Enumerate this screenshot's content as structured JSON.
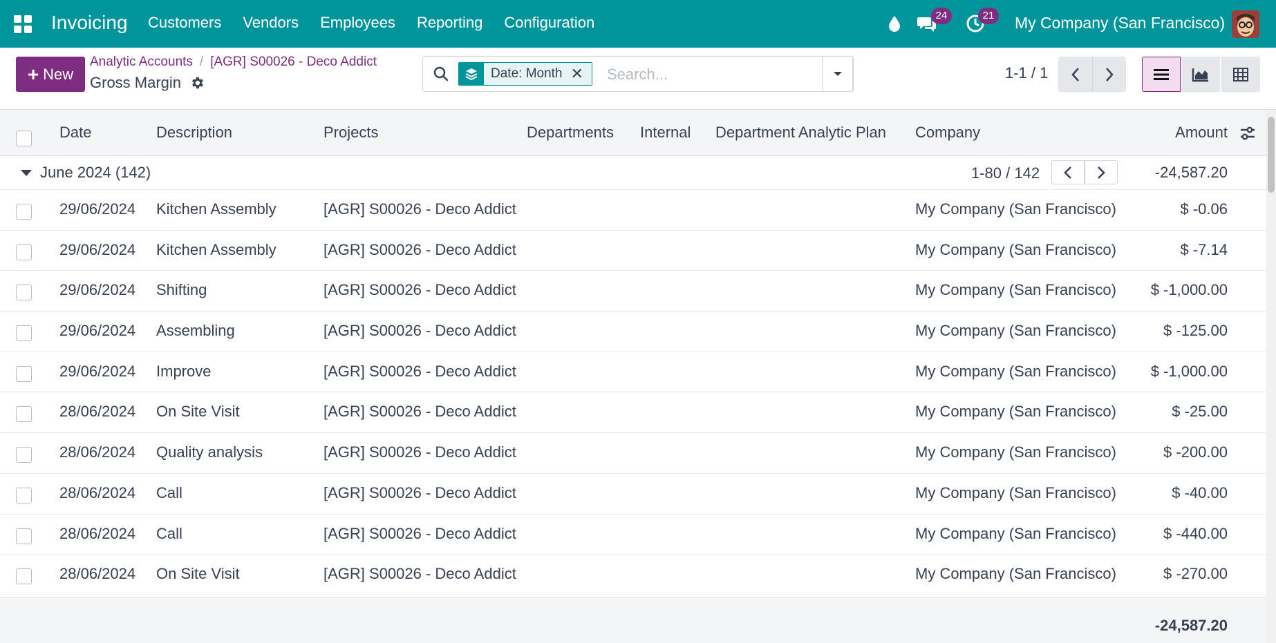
{
  "navbar": {
    "brand": "Invoicing",
    "menu": [
      "Customers",
      "Vendors",
      "Employees",
      "Reporting",
      "Configuration"
    ],
    "messages_count": "24",
    "activities_count": "21",
    "company": "My Company (San Francisco)",
    "accent_color": "#00959a"
  },
  "control": {
    "new_label": "New",
    "breadcrumb": [
      "Analytic Accounts",
      "[AGR] S00026 - Deco Addict"
    ],
    "breadcrumb_sep": "/",
    "title": "Gross Margin",
    "facet_label": "Date: Month",
    "search_placeholder": "Search...",
    "pager": "1-1 / 1",
    "brand_color": "#7e2d80"
  },
  "table": {
    "columns": [
      "Date",
      "Description",
      "Projects",
      "Departments",
      "Internal",
      "Department Analytic Plan",
      "Company",
      "Amount"
    ],
    "group": {
      "label": "June 2024 (142)",
      "pager": "1-80 / 142",
      "total": "-24,587.20"
    },
    "rows": [
      {
        "date": "29/06/2024",
        "description": "Kitchen Assembly",
        "project": "[AGR] S00026 - Deco Addict",
        "company": "My Company (San Francisco)",
        "amount": "$ -0.06"
      },
      {
        "date": "29/06/2024",
        "description": "Kitchen Assembly",
        "project": "[AGR] S00026 - Deco Addict",
        "company": "My Company (San Francisco)",
        "amount": "$ -7.14"
      },
      {
        "date": "29/06/2024",
        "description": "Shifting",
        "project": "[AGR] S00026 - Deco Addict",
        "company": "My Company (San Francisco)",
        "amount": "$ -1,000.00"
      },
      {
        "date": "29/06/2024",
        "description": "Assembling",
        "project": "[AGR] S00026 - Deco Addict",
        "company": "My Company (San Francisco)",
        "amount": "$ -125.00"
      },
      {
        "date": "29/06/2024",
        "description": "Improve",
        "project": "[AGR] S00026 - Deco Addict",
        "company": "My Company (San Francisco)",
        "amount": "$ -1,000.00"
      },
      {
        "date": "28/06/2024",
        "description": "On Site Visit",
        "project": "[AGR] S00026 - Deco Addict",
        "company": "My Company (San Francisco)",
        "amount": "$ -25.00"
      },
      {
        "date": "28/06/2024",
        "description": "Quality analysis",
        "project": "[AGR] S00026 - Deco Addict",
        "company": "My Company (San Francisco)",
        "amount": "$ -200.00"
      },
      {
        "date": "28/06/2024",
        "description": "Call",
        "project": "[AGR] S00026 - Deco Addict",
        "company": "My Company (San Francisco)",
        "amount": "$ -40.00"
      },
      {
        "date": "28/06/2024",
        "description": "Call",
        "project": "[AGR] S00026 - Deco Addict",
        "company": "My Company (San Francisco)",
        "amount": "$ -440.00"
      },
      {
        "date": "28/06/2024",
        "description": "On Site Visit",
        "project": "[AGR] S00026 - Deco Addict",
        "company": "My Company (San Francisco)",
        "amount": "$ -270.00"
      }
    ],
    "footer_total": "-24,587.20"
  }
}
